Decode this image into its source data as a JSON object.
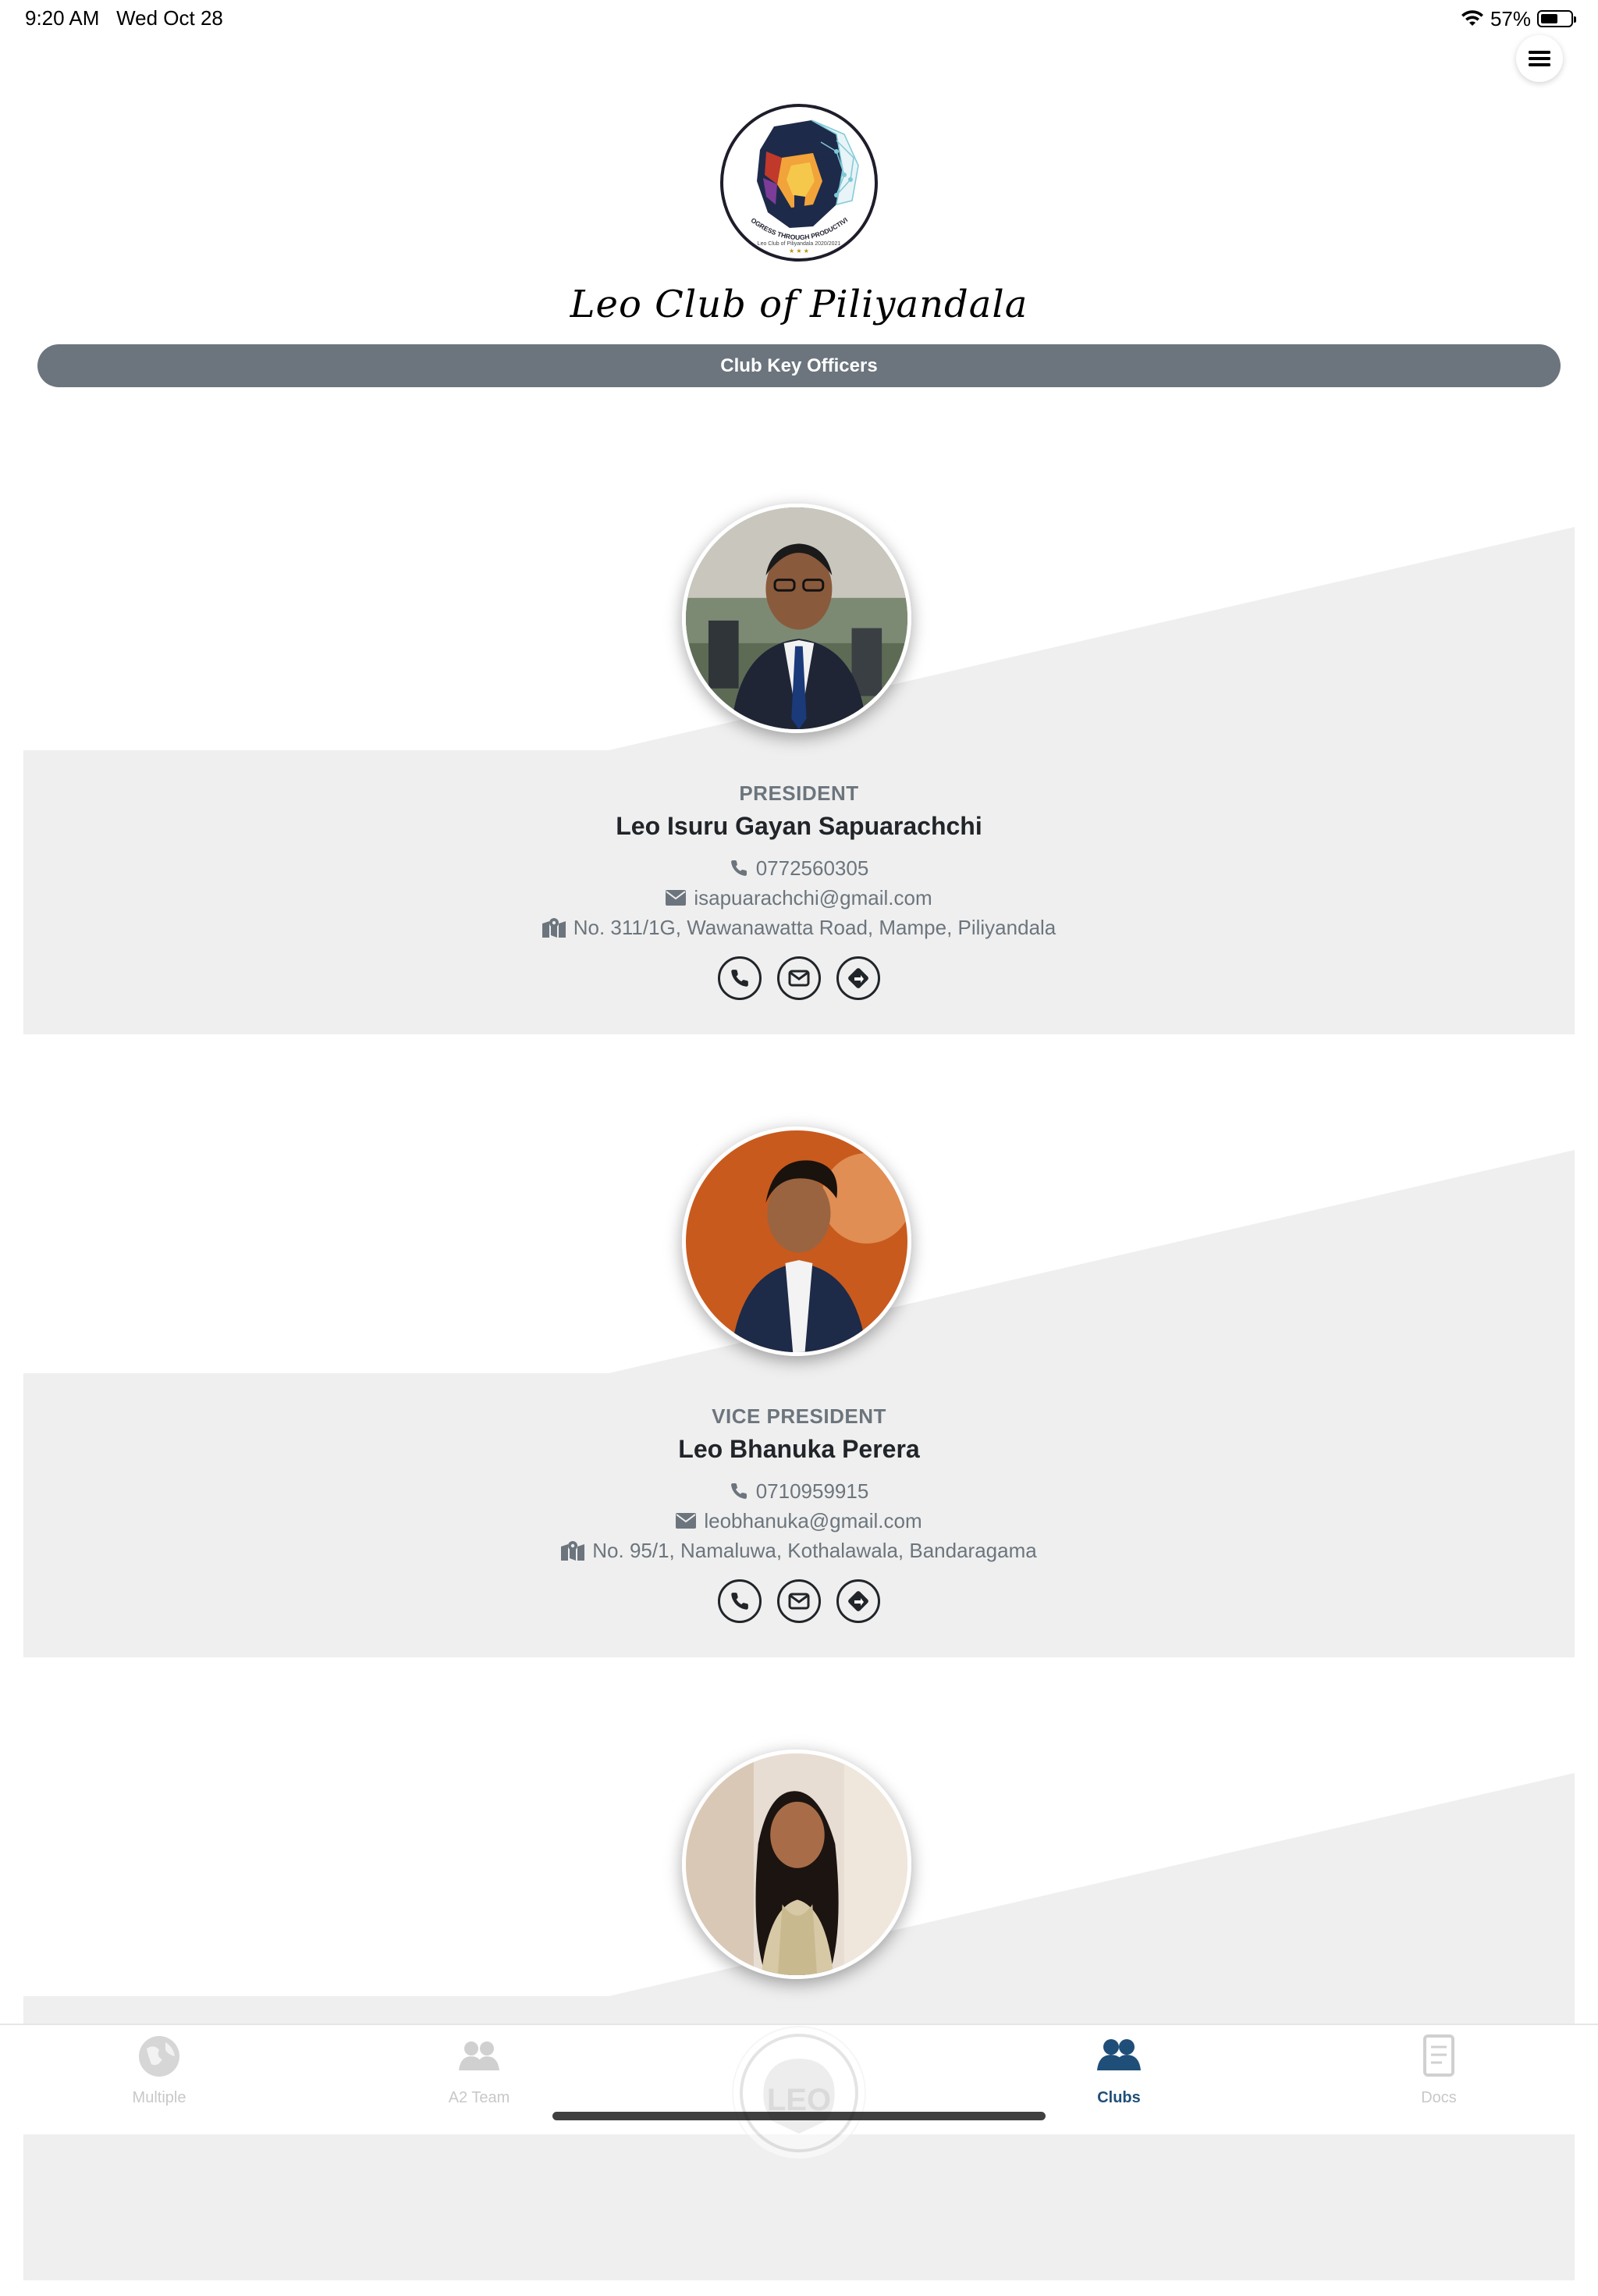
{
  "status_bar": {
    "time": "9:20 AM",
    "date": "Wed Oct 28",
    "battery_text": "57%",
    "battery_level": 0.57,
    "icons": [
      "wifi-icon",
      "battery-icon"
    ]
  },
  "header": {
    "menu_icon": "hamburger-menu-icon",
    "club_name": "Leo Club of Piliyandala",
    "logo_text": [
      "PROGRESS THROUGH PRODUCTIVITY",
      "Leo Club of Piliyandala 2020/2021"
    ],
    "section_label": "Club Key Officers"
  },
  "officers": [
    {
      "role": "PRESIDENT",
      "name": "Leo Isuru Gayan Sapuarachchi",
      "phone": "0772560305",
      "email": "isapuarachchi@gmail.com",
      "address": "No. 311/1G, Wawanawatta Road, Mampe, Piliyandala"
    },
    {
      "role": "VICE PRESIDENT",
      "name": "Leo Bhanuka Perera",
      "phone": "0710959915",
      "email": "leobhanuka@gmail.com",
      "address": "No. 95/1, Namaluwa, Kothalawala, Bandaragama"
    },
    {
      "role": "",
      "name": "",
      "phone": "",
      "email": "",
      "address": ""
    }
  ],
  "tab_bar": {
    "tabs": [
      {
        "label": "Multiple",
        "icon": "globe-icon",
        "active": false
      },
      {
        "label": "A2 Team",
        "icon": "users-icon",
        "active": false
      },
      {
        "label": "Clubs",
        "icon": "users-icon",
        "active": true
      },
      {
        "label": "Docs",
        "icon": "document-icon",
        "active": false
      }
    ],
    "center_icon": "leo-emblem-icon",
    "center_emblem_text": "LEO"
  },
  "colors": {
    "pill": "#6c757d",
    "card_bg": "#efefef",
    "active_tab": "#1f4e79",
    "inactive_tab": "#c8c8c8",
    "text_dark": "#212529",
    "text_muted": "#6c757d"
  }
}
